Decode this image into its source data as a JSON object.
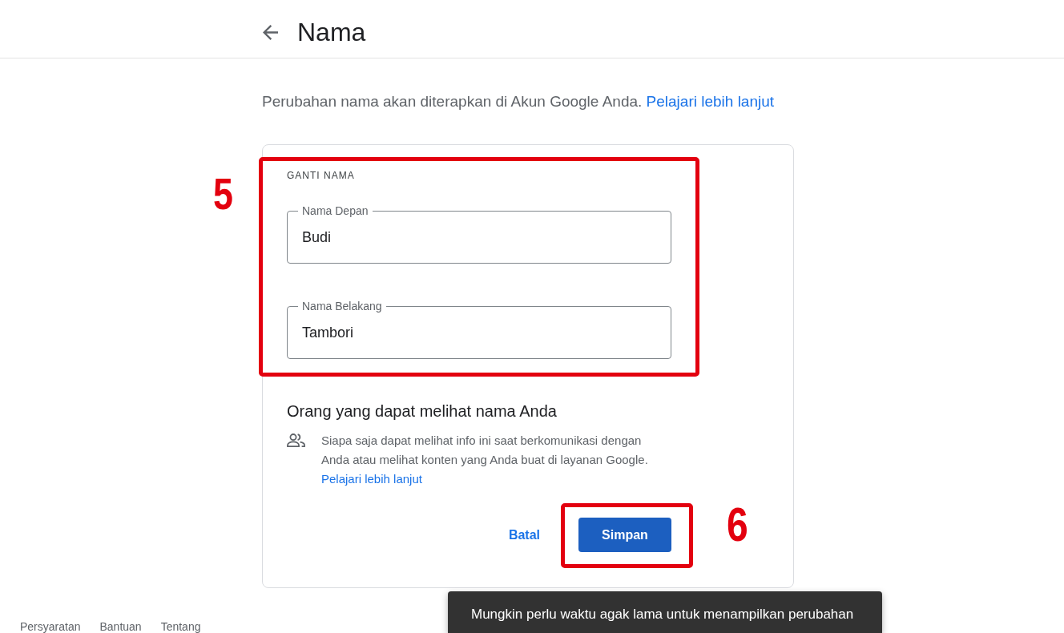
{
  "header": {
    "title": "Nama"
  },
  "intro": {
    "text": "Perubahan nama akan diterapkan di Akun Google Anda.",
    "link": "Pelajari lebih lanjut"
  },
  "name_section": {
    "heading": "GANTI NAMA",
    "fields": [
      {
        "label": "Nama Depan",
        "value": "Budi"
      },
      {
        "label": "Nama Belakang",
        "value": "Tambori"
      }
    ],
    "annotation": {
      "label": "5"
    }
  },
  "visibility": {
    "heading": "Orang yang dapat melihat nama Anda",
    "text": "Siapa saja dapat melihat info ini saat berkomunikasi dengan Anda atau melihat konten yang Anda buat di layanan Google.",
    "link": "Pelajari lebih lanjut"
  },
  "actions": {
    "cancel": "Batal",
    "save": "Simpan",
    "annotation": {
      "label": "6"
    }
  },
  "footer": {
    "links": [
      "Persyaratan",
      "Bantuan",
      "Tentang"
    ]
  },
  "toast": {
    "text": "Mungkin perlu waktu agak lama untuk menampilkan perubahan"
  }
}
